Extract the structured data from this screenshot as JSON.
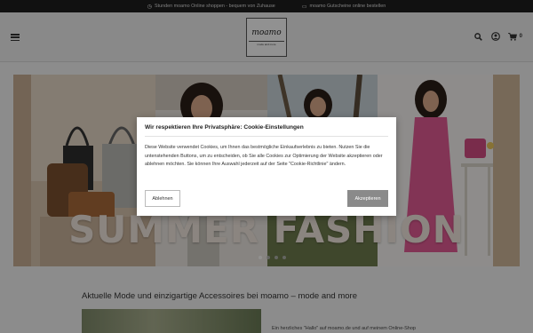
{
  "topbar": {
    "promo_1": "Stunden moamo Online shoppen - bequem von Zuhause",
    "promo_2": "moamo Gutscheine online bestellen"
  },
  "header": {
    "logo_brand": "moamo",
    "logo_tagline": "mode and more",
    "cart_count": "0"
  },
  "hero": {
    "title": "SUMMER FASHION",
    "slides_total": 4,
    "active_slide": 1
  },
  "content": {
    "heading": "Aktuelle Mode und einzigartige Accessoires bei moamo – mode and more",
    "intro_text": "Ein herzliches \"Hallo\" auf moamo.de und auf meinem Online-Shop"
  },
  "cookie_modal": {
    "title": "Wir respektieren Ihre Privatsphäre: Cookie-Einstellungen",
    "body": "Diese Website verwendet Cookies, um Ihnen das bestmögliche Einkaufserlebnis zu bieten. Nutzen Sie die untenstehenden Buttons, um zu entscheiden, ob Sie alle Cookies zur Optimierung der Website akzeptieren oder ablehnen möchten. Sie können Ihre Auswahl jederzeit auf der Seite \"Cookie-Richtlinie\" ändern.",
    "decline_label": "Ablehnen",
    "accept_label": "Akzeptieren"
  },
  "icons": {
    "menu": "hamburger-menu-icon",
    "search": "search-icon",
    "account": "user-icon",
    "cart": "cart-icon"
  }
}
